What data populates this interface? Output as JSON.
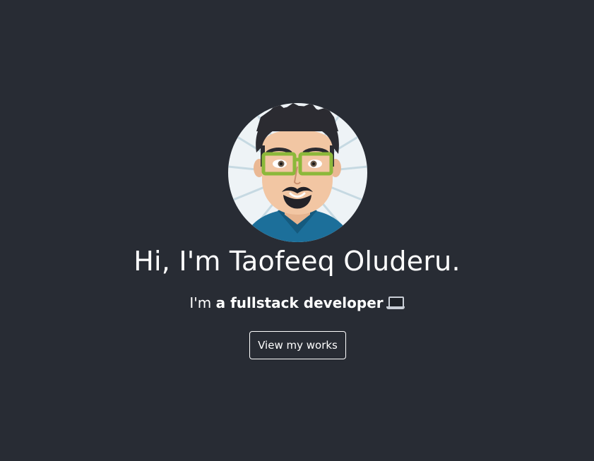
{
  "hero": {
    "avatar_alt": "avatar",
    "title": "Hi, I'm Taofeeq Oluderu.",
    "subtitle_prefix": "I'm ",
    "subtitle_strong": "a fullstack developer",
    "subtitle_icon": "laptop-icon",
    "cta_label": "View my works"
  },
  "colors": {
    "background": "#282c34",
    "text": "#ffffff",
    "glasses": "#8cb83a",
    "shirt": "#1c6f9a"
  }
}
